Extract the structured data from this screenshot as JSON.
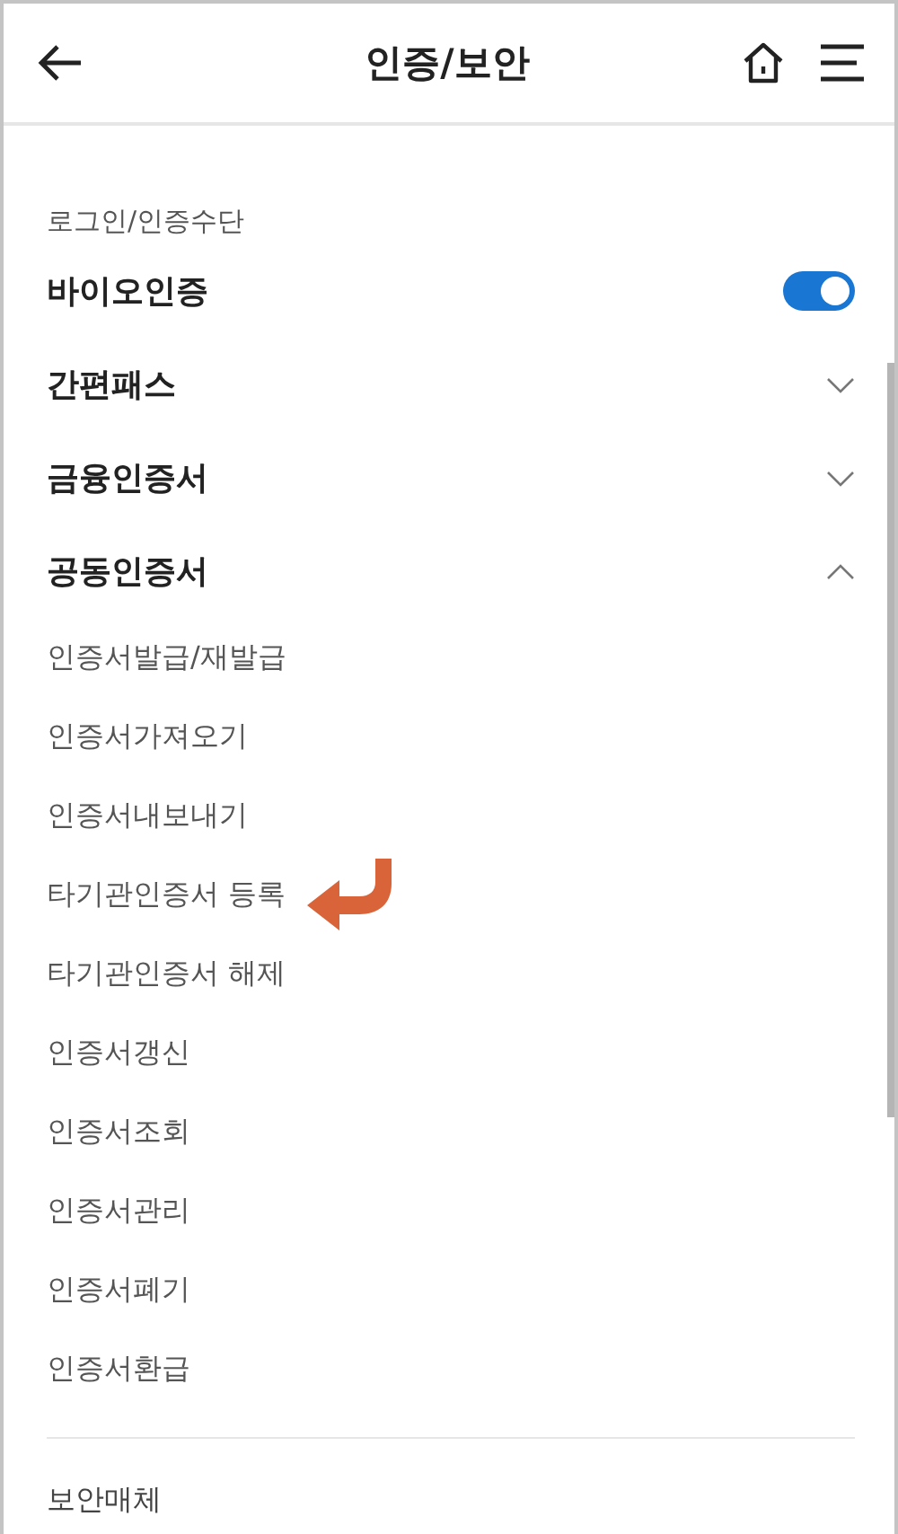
{
  "header": {
    "title": "인증/보안"
  },
  "section_label": "로그인/인증수단",
  "rows": [
    {
      "kind": "toggle",
      "label": "바이오인증",
      "on": true
    },
    {
      "kind": "expandable",
      "label": "간편패스",
      "expanded": false
    },
    {
      "kind": "expandable",
      "label": "금융인증서",
      "expanded": false
    },
    {
      "kind": "expandable",
      "label": "공동인증서",
      "expanded": true,
      "children": [
        {
          "label": "인증서발급/재발급",
          "pointed": false
        },
        {
          "label": "인증서가져오기",
          "pointed": false
        },
        {
          "label": "인증서내보내기",
          "pointed": false
        },
        {
          "label": "타기관인증서 등록",
          "pointed": true
        },
        {
          "label": "타기관인증서 해제",
          "pointed": false
        },
        {
          "label": "인증서갱신",
          "pointed": false
        },
        {
          "label": "인증서조회",
          "pointed": false
        },
        {
          "label": "인증서관리",
          "pointed": false
        },
        {
          "label": "인증서폐기",
          "pointed": false
        },
        {
          "label": "인증서환급",
          "pointed": false
        }
      ]
    }
  ],
  "next_section": "보안매체"
}
